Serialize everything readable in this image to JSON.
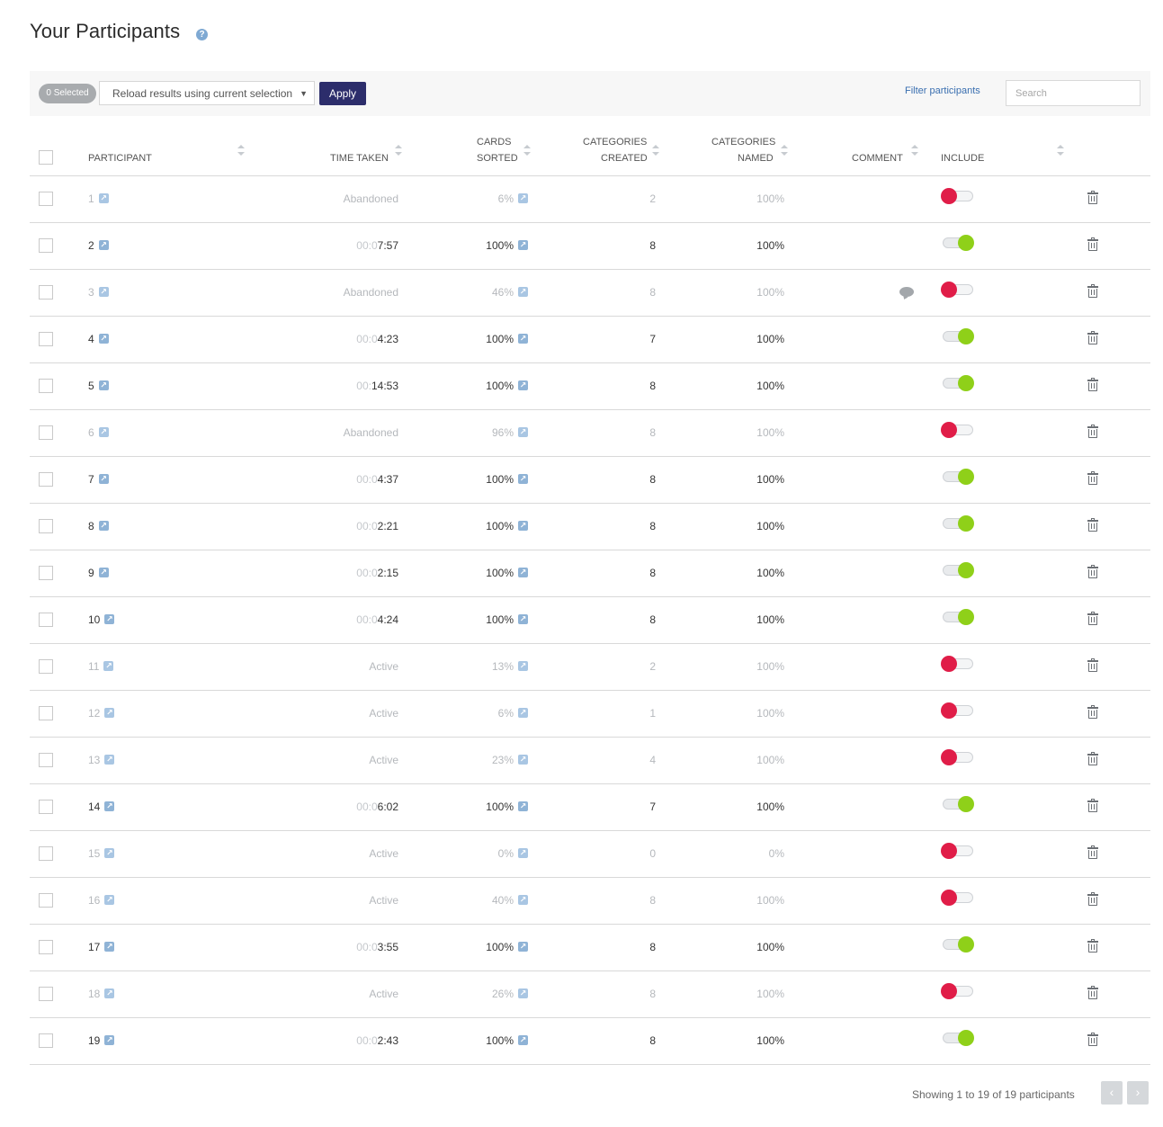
{
  "page": {
    "title": "Your Participants",
    "help_icon": "?"
  },
  "toolbar": {
    "selected_badge": "0 Selected",
    "reload_select_value": "Reload results using current selection",
    "apply_label": "Apply",
    "filter_link": "Filter participants",
    "search_placeholder": "Search"
  },
  "columns": {
    "participant": "PARTICIPANT",
    "time_taken": "TIME TAKEN",
    "cards_sorted_1": "CARDS",
    "cards_sorted_2": "SORTED",
    "categories_created_1": "CATEGORIES",
    "categories_created_2": "CREATED",
    "categories_named_1": "CATEGORIES",
    "categories_named_2": "NAMED",
    "comment": "COMMENT",
    "include": "INCLUDE"
  },
  "rows": [
    {
      "id": "1",
      "dim": true,
      "time_prefix": "",
      "time": "Abandoned",
      "cards": "6%",
      "created": "2",
      "named": "100%",
      "comment": false,
      "include": false
    },
    {
      "id": "2",
      "dim": false,
      "time_prefix": "00:0",
      "time": "7:57",
      "cards": "100%",
      "created": "8",
      "named": "100%",
      "comment": false,
      "include": true
    },
    {
      "id": "3",
      "dim": true,
      "time_prefix": "",
      "time": "Abandoned",
      "cards": "46%",
      "created": "8",
      "named": "100%",
      "comment": true,
      "include": false
    },
    {
      "id": "4",
      "dim": false,
      "time_prefix": "00:0",
      "time": "4:23",
      "cards": "100%",
      "created": "7",
      "named": "100%",
      "comment": false,
      "include": true
    },
    {
      "id": "5",
      "dim": false,
      "time_prefix": "00:",
      "time": "14:53",
      "cards": "100%",
      "created": "8",
      "named": "100%",
      "comment": false,
      "include": true
    },
    {
      "id": "6",
      "dim": true,
      "time_prefix": "",
      "time": "Abandoned",
      "cards": "96%",
      "created": "8",
      "named": "100%",
      "comment": false,
      "include": false
    },
    {
      "id": "7",
      "dim": false,
      "time_prefix": "00:0",
      "time": "4:37",
      "cards": "100%",
      "created": "8",
      "named": "100%",
      "comment": false,
      "include": true
    },
    {
      "id": "8",
      "dim": false,
      "time_prefix": "00:0",
      "time": "2:21",
      "cards": "100%",
      "created": "8",
      "named": "100%",
      "comment": false,
      "include": true
    },
    {
      "id": "9",
      "dim": false,
      "time_prefix": "00:0",
      "time": "2:15",
      "cards": "100%",
      "created": "8",
      "named": "100%",
      "comment": false,
      "include": true
    },
    {
      "id": "10",
      "dim": false,
      "time_prefix": "00:0",
      "time": "4:24",
      "cards": "100%",
      "created": "8",
      "named": "100%",
      "comment": false,
      "include": true
    },
    {
      "id": "11",
      "dim": true,
      "time_prefix": "",
      "time": "Active",
      "cards": "13%",
      "created": "2",
      "named": "100%",
      "comment": false,
      "include": false
    },
    {
      "id": "12",
      "dim": true,
      "time_prefix": "",
      "time": "Active",
      "cards": "6%",
      "created": "1",
      "named": "100%",
      "comment": false,
      "include": false
    },
    {
      "id": "13",
      "dim": true,
      "time_prefix": "",
      "time": "Active",
      "cards": "23%",
      "created": "4",
      "named": "100%",
      "comment": false,
      "include": false
    },
    {
      "id": "14",
      "dim": false,
      "time_prefix": "00:0",
      "time": "6:02",
      "cards": "100%",
      "created": "7",
      "named": "100%",
      "comment": false,
      "include": true
    },
    {
      "id": "15",
      "dim": true,
      "time_prefix": "",
      "time": "Active",
      "cards": "0%",
      "created": "0",
      "named": "0%",
      "comment": false,
      "include": false
    },
    {
      "id": "16",
      "dim": true,
      "time_prefix": "",
      "time": "Active",
      "cards": "40%",
      "created": "8",
      "named": "100%",
      "comment": false,
      "include": false
    },
    {
      "id": "17",
      "dim": false,
      "time_prefix": "00:0",
      "time": "3:55",
      "cards": "100%",
      "created": "8",
      "named": "100%",
      "comment": false,
      "include": true
    },
    {
      "id": "18",
      "dim": true,
      "time_prefix": "",
      "time": "Active",
      "cards": "26%",
      "created": "8",
      "named": "100%",
      "comment": false,
      "include": false
    },
    {
      "id": "19",
      "dim": false,
      "time_prefix": "00:0",
      "time": "2:43",
      "cards": "100%",
      "created": "8",
      "named": "100%",
      "comment": false,
      "include": true
    }
  ],
  "footer": {
    "showing": "Showing 1 to 19 of 19 participants",
    "prev": "‹",
    "next": "›"
  },
  "colors": {
    "include_on": "#8fd019",
    "include_off": "#e01d48",
    "apply_bg": "#2c2d6b",
    "link": "#3a6fb0"
  },
  "icons": [
    "help-icon",
    "link-icon",
    "comment-icon",
    "trash-icon",
    "sort-icon",
    "chevron-left-icon",
    "chevron-right-icon"
  ]
}
